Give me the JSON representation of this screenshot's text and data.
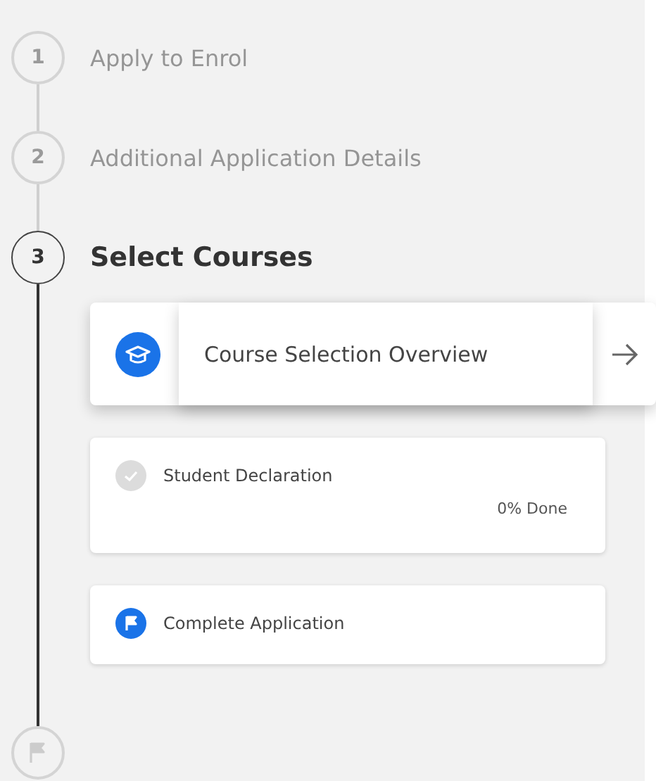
{
  "steps": [
    {
      "number": "1",
      "title": "Apply to Enrol",
      "selected": false
    },
    {
      "number": "2",
      "title": "Additional Application Details",
      "selected": false
    },
    {
      "number": "3",
      "title": "Select Courses",
      "selected": true,
      "tasks": [
        {
          "kind": "overview",
          "title": "Course Selection Overview"
        },
        {
          "kind": "declaration",
          "title": "Student Declaration",
          "progress": "0% Done",
          "completed": false
        },
        {
          "kind": "final",
          "title": "Complete Application"
        }
      ]
    }
  ]
}
